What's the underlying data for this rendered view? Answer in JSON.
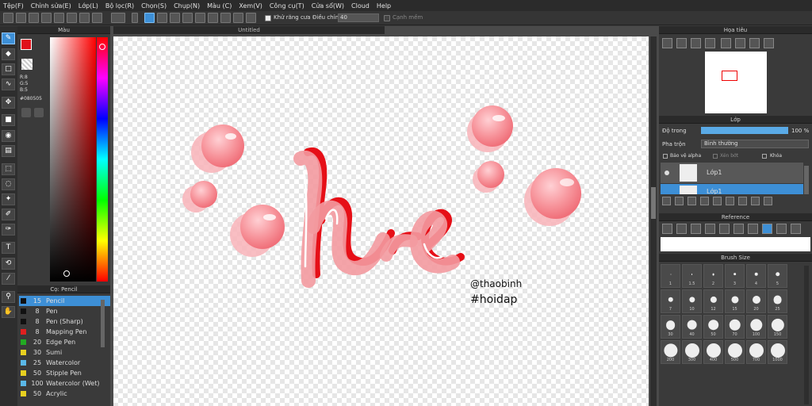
{
  "menu": [
    "Tệp(F)",
    "Chỉnh sửa(E)",
    "Lớp(L)",
    "Bộ lọc(R)",
    "Chọn(S)",
    "Chụp(N)",
    "Màu (C)",
    "Xem(V)",
    "Công cụ(T)",
    "Cửa sổ(W)",
    "Cloud",
    "Help"
  ],
  "toolbar": {
    "antialias_label": "Khử răng cưa",
    "adjust_label": "Điều chỉnh",
    "adjust_value": "40",
    "soft_label": "Cạnh mềm"
  },
  "color_panel": {
    "title": "Màu",
    "r": "R:8",
    "g": "G:5",
    "b": "B:5",
    "hex": "#080505",
    "primary": "#e0101a",
    "hue": "#ff0000"
  },
  "brush_panel": {
    "title": "Cọ: Pencil",
    "items": [
      {
        "size": "15",
        "name": "Pencil",
        "color": "#111111"
      },
      {
        "size": "8",
        "name": "Pen",
        "color": "#111111"
      },
      {
        "size": "8",
        "name": "Pen (Sharp)",
        "color": "#111111"
      },
      {
        "size": "8",
        "name": "Mapping Pen",
        "color": "#e02020"
      },
      {
        "size": "20",
        "name": "Edge Pen",
        "color": "#22aa22"
      },
      {
        "size": "30",
        "name": "Sumi",
        "color": "#e8d020"
      },
      {
        "size": "25",
        "name": "Watercolor",
        "color": "#5ab8e8"
      },
      {
        "size": "50",
        "name": "Stipple Pen",
        "color": "#e8d020"
      },
      {
        "size": "100",
        "name": "Watercolor (Wet)",
        "color": "#5ab8e8"
      },
      {
        "size": "50",
        "name": "Acrylic",
        "color": "#e8d020"
      }
    ]
  },
  "canvas": {
    "tab": "Untitled",
    "signature_1": "@thaobinh",
    "signature_2": "#hoidap"
  },
  "navigator": {
    "title": "Họa tiêu"
  },
  "layer_panel": {
    "title": "Lớp",
    "opacity_label": "Độ trong",
    "opacity_value": "100 %",
    "blend_label": "Pha trộn",
    "blend_value": "Bình thường",
    "protect_alpha": "Bảo vệ alpha",
    "clip": "Xén bớt",
    "lock": "Khóa",
    "layers": [
      "Lớp1",
      "Lớp1"
    ]
  },
  "reference": {
    "title": "Reference"
  },
  "brush_size": {
    "title": "Brush Size",
    "sizes": [
      "1",
      "1.5",
      "2",
      "3",
      "4",
      "5",
      "7",
      "10",
      "12",
      "15",
      "20",
      "25",
      "30",
      "40",
      "50",
      "70",
      "100",
      "150",
      "200",
      "300",
      "400",
      "500",
      "700",
      "1000"
    ]
  }
}
